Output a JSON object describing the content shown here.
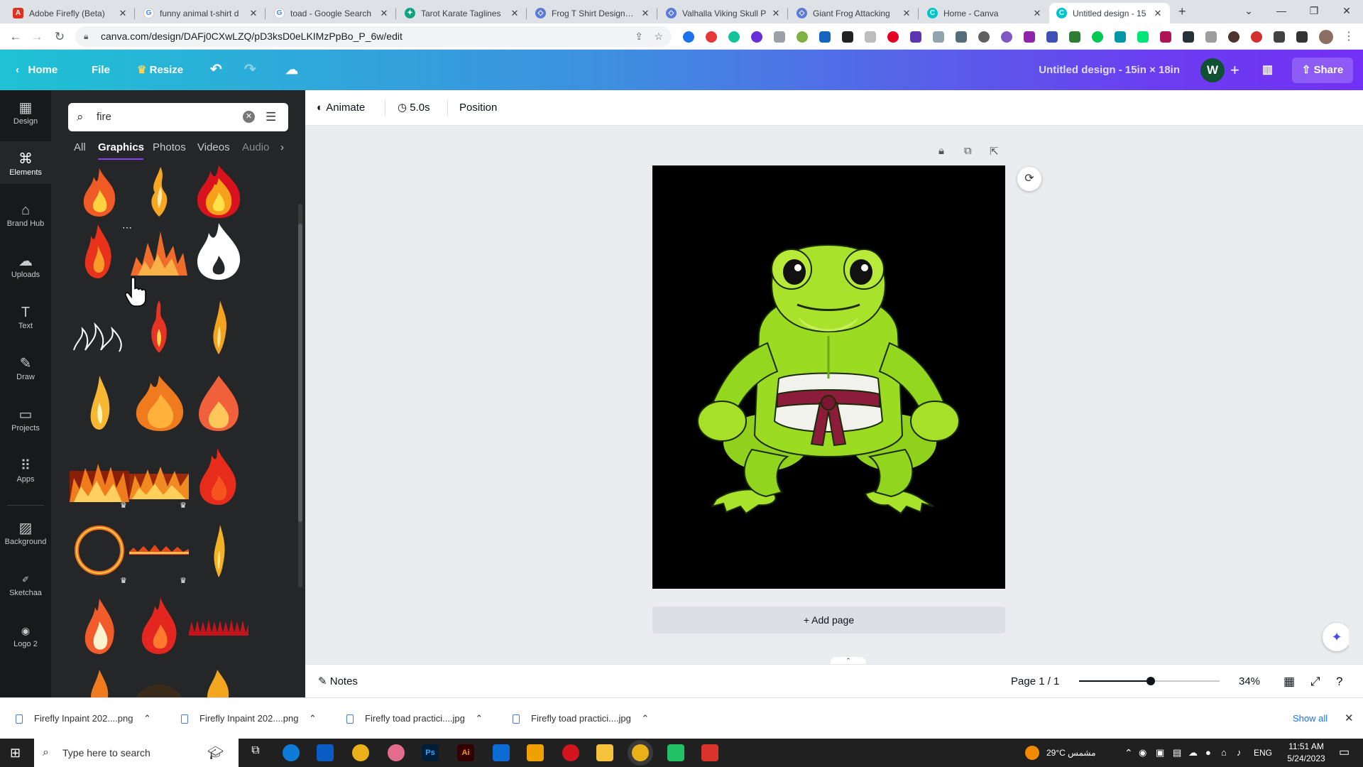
{
  "browser": {
    "tabs": [
      {
        "title": "Adobe Firefly (Beta)",
        "icon": "adobe-icon",
        "color": "#e0301e"
      },
      {
        "title": "funny animal t-shirt d",
        "icon": "google-icon",
        "color": "#4285f4"
      },
      {
        "title": "toad - Google Search",
        "icon": "google-icon",
        "color": "#4285f4"
      },
      {
        "title": "Tarot Karate Taglines",
        "icon": "openai-icon",
        "color": "#10a37f"
      },
      {
        "title": "Frog T Shirt Designs G",
        "icon": "globe-icon",
        "color": "#5a7bd8"
      },
      {
        "title": "Valhalla Viking Skull P",
        "icon": "globe-icon",
        "color": "#5a7bd8"
      },
      {
        "title": "Giant Frog Attacking",
        "icon": "globe-icon",
        "color": "#5a7bd8"
      },
      {
        "title": "Home - Canva",
        "icon": "canva-icon",
        "color": "#00c4cc"
      },
      {
        "title": "Untitled design - 15",
        "icon": "canva-icon",
        "color": "#00c4cc"
      }
    ],
    "url": "canva.com/design/DAFj0CXwLZQ/pD3ksD0eLKIMzPpBo_P_6w/edit"
  },
  "header": {
    "home": "Home",
    "file": "File",
    "resize": "Resize",
    "design_title": "Untitled design - 15in × 18in",
    "avatar_initial": "W",
    "share": "Share"
  },
  "rail": [
    {
      "label": "Design",
      "icon": "design-icon"
    },
    {
      "label": "Elements",
      "icon": "elements-icon"
    },
    {
      "label": "Brand Hub",
      "icon": "brand-hub-icon"
    },
    {
      "label": "Uploads",
      "icon": "uploads-icon"
    },
    {
      "label": "Text",
      "icon": "text-icon"
    },
    {
      "label": "Draw",
      "icon": "draw-icon"
    },
    {
      "label": "Projects",
      "icon": "projects-icon"
    },
    {
      "label": "Apps",
      "icon": "apps-icon"
    },
    {
      "label": "Background",
      "icon": "background-icon"
    },
    {
      "label": "Sketchaa",
      "icon": "sketchaa-icon"
    },
    {
      "label": "Logo 2",
      "icon": "logo-icon"
    }
  ],
  "panel": {
    "search_value": "fire",
    "tabs": [
      "All",
      "Graphics",
      "Photos",
      "Videos",
      "Audio"
    ],
    "active_tab": "Graphics"
  },
  "toolbar": {
    "animate": "Animate",
    "duration": "5.0s",
    "position": "Position"
  },
  "canvas": {
    "add_page": "+ Add page"
  },
  "statusbar": {
    "notes": "Notes",
    "page": "Page 1 / 1",
    "zoom": "34%",
    "zoom_level": 0.34
  },
  "downloads": {
    "items": [
      "Firefly Inpaint 202....png",
      "Firefly Inpaint 202....png",
      "Firefly toad practici....jpg",
      "Firefly toad practici....jpg"
    ],
    "show_all": "Show all"
  },
  "taskbar": {
    "search_placeholder": "Type here to search",
    "weather": "29°C  مشمس",
    "lang": "ENG",
    "time": "11:51 AM",
    "date": "5/24/2023"
  }
}
